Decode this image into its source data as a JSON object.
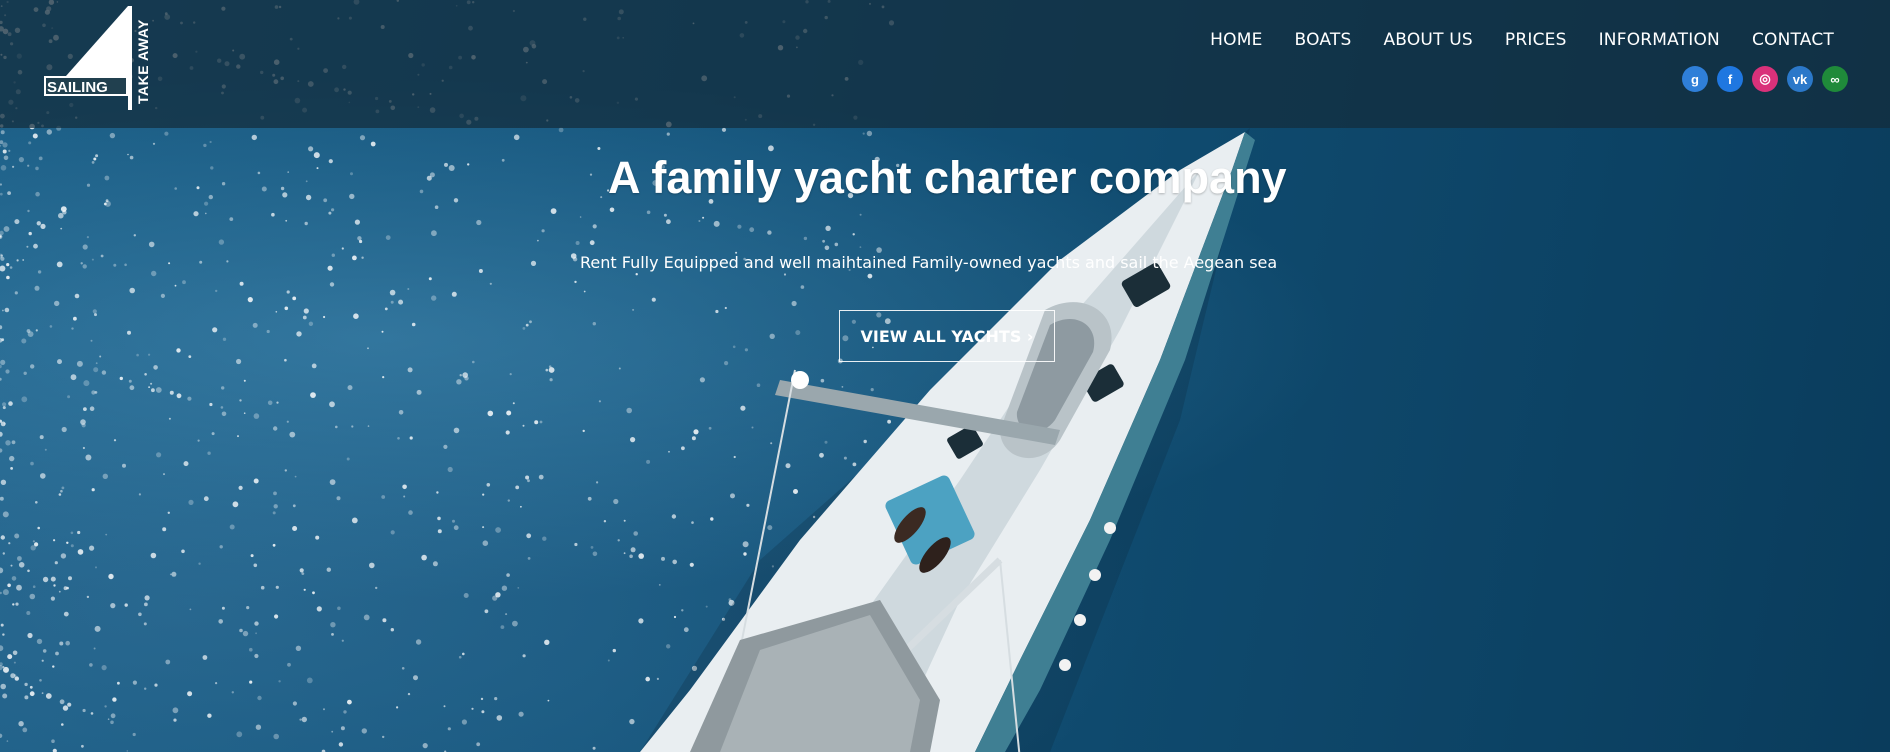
{
  "logo": {
    "main_text": "SAILING",
    "side_text": "TAKE AWAY"
  },
  "nav": {
    "items": [
      {
        "label": "HOME"
      },
      {
        "label": "BOATS"
      },
      {
        "label": "ABOUT US"
      },
      {
        "label": "PRICES"
      },
      {
        "label": "INFORMATION"
      },
      {
        "label": "CONTACT"
      }
    ]
  },
  "social": {
    "icons": [
      {
        "name": "google-plus-icon",
        "glyph": "g",
        "color": "#2f7fd8"
      },
      {
        "name": "facebook-icon",
        "glyph": "f",
        "color": "#1f77e0"
      },
      {
        "name": "instagram-icon",
        "glyph": "◎",
        "color": "#d9317a"
      },
      {
        "name": "vk-icon",
        "glyph": "vk",
        "color": "#2b78c9"
      },
      {
        "name": "tripadvisor-icon",
        "glyph": "∞",
        "color": "#1f8a3a"
      }
    ]
  },
  "hero": {
    "title": "A family yacht charter company",
    "subtitle": "Rent Fully Equipped and well maihtained Family-owned yachts and sail the Aegean sea",
    "cta_label": "VIEW ALL YACHTS ›"
  },
  "colors": {
    "header_overlay": "#142d3c",
    "sea_dark": "#0a3c5c",
    "sea_light": "#1b5e86"
  }
}
